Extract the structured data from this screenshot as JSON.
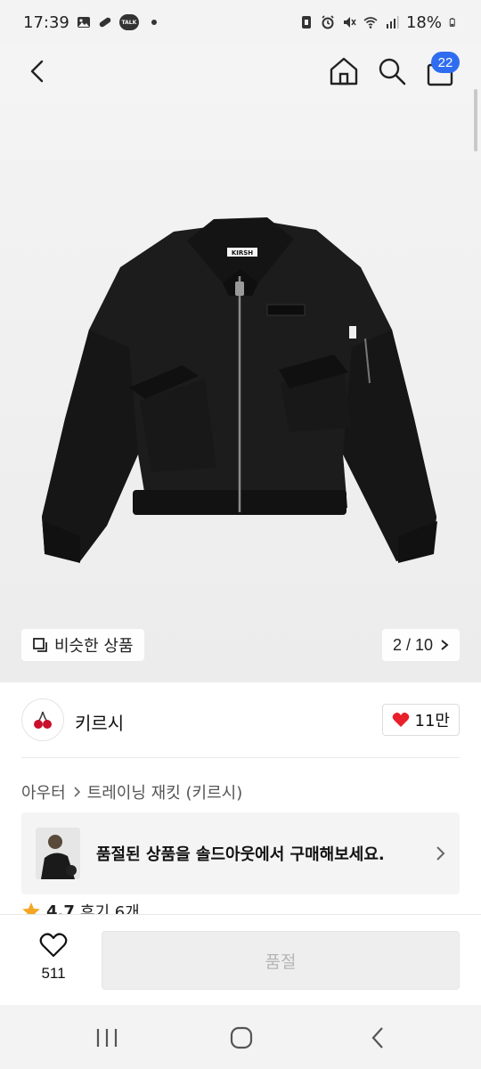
{
  "status_bar": {
    "time": "17:39",
    "talk": "TALK",
    "battery": "18%"
  },
  "header": {
    "cart_count": "22"
  },
  "gallery": {
    "similar_label": "비슷한 상품",
    "page_indicator": "2 / 10",
    "brand_tag": "KIRSH"
  },
  "brand": {
    "name": "키르시",
    "likes": "11만"
  },
  "breadcrumb": {
    "category": "아우터",
    "subcategory": "트레이닝 재킷 (키르시)"
  },
  "soldout_banner": {
    "text": "품절된 상품을 솔드아웃에서 구매해보세요."
  },
  "rating": {
    "score": "4.7",
    "reviews": "후기 6개"
  },
  "bottom_bar": {
    "wish_count": "511",
    "buy_label": "품절"
  },
  "colors": {
    "accent": "#2f6df0",
    "heart": "#e8202a",
    "star": "#f5a623"
  }
}
